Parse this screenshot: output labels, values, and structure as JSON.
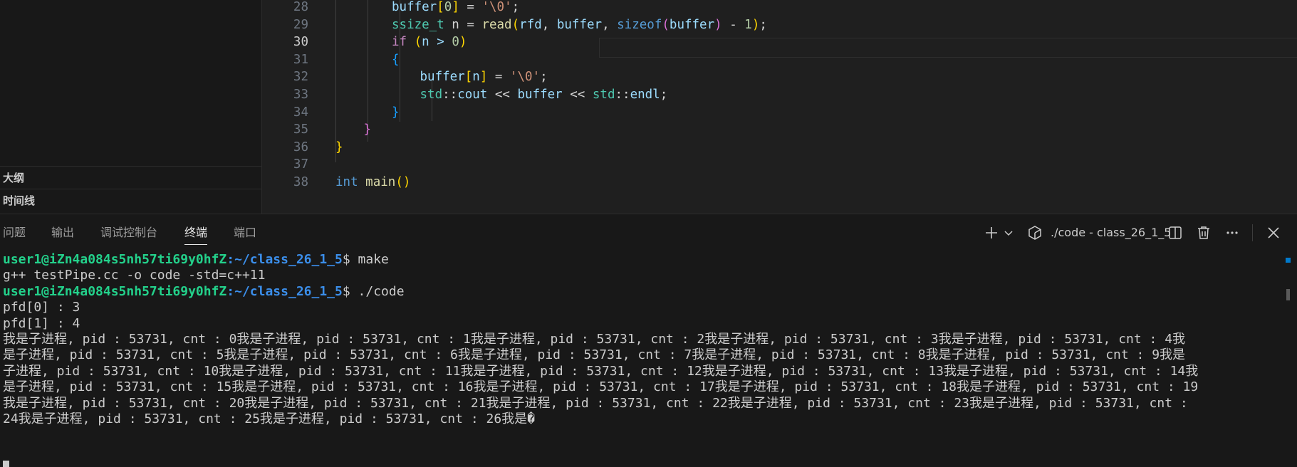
{
  "sidebar": {
    "sections": [
      "大纲",
      "时间线"
    ]
  },
  "editor": {
    "active_line": 30,
    "lines": [
      {
        "n": "28",
        "tokens": [
          [
            "buffer",
            "var"
          ],
          [
            "[",
            "b1"
          ],
          [
            "0",
            "num"
          ],
          [
            "]",
            "b1"
          ],
          [
            " = ",
            "op"
          ],
          [
            "'\\0'",
            "str"
          ],
          [
            ";",
            "op"
          ]
        ]
      },
      {
        "n": "29",
        "tokens": [
          [
            "ssize_t",
            "type"
          ],
          [
            " n = ",
            "op"
          ],
          [
            "read",
            "fn"
          ],
          [
            "(",
            "b1"
          ],
          [
            "rfd",
            "var"
          ],
          [
            ", ",
            "op"
          ],
          [
            "buffer",
            "var"
          ],
          [
            ", ",
            "op"
          ],
          [
            "sizeof",
            "kw"
          ],
          [
            "(",
            "b2"
          ],
          [
            "buffer",
            "var"
          ],
          [
            ")",
            "b2"
          ],
          [
            " - ",
            "op"
          ],
          [
            "1",
            "num"
          ],
          [
            ")",
            "b1"
          ],
          [
            ";",
            "op"
          ]
        ]
      },
      {
        "n": "30",
        "tokens": [
          [
            "if",
            "ctl"
          ],
          [
            " ",
            "op"
          ],
          [
            "(",
            "b1"
          ],
          [
            "n > ",
            "var"
          ],
          [
            "0",
            "num"
          ],
          [
            ")",
            "b1"
          ]
        ]
      },
      {
        "n": "31",
        "tokens": [
          [
            "{",
            "b3"
          ]
        ]
      },
      {
        "n": "32",
        "tokens": [
          [
            "buffer",
            "var"
          ],
          [
            "[",
            "b1"
          ],
          [
            "n",
            "var"
          ],
          [
            "]",
            "b1"
          ],
          [
            " = ",
            "op"
          ],
          [
            "'\\0'",
            "str"
          ],
          [
            ";",
            "op"
          ]
        ]
      },
      {
        "n": "33",
        "tokens": [
          [
            "std",
            "type"
          ],
          [
            "::",
            "op"
          ],
          [
            "cout",
            "var"
          ],
          [
            " << ",
            "op"
          ],
          [
            "buffer",
            "var"
          ],
          [
            " << ",
            "op"
          ],
          [
            "std",
            "type"
          ],
          [
            "::",
            "op"
          ],
          [
            "endl",
            "var"
          ],
          [
            ";",
            "op"
          ]
        ]
      },
      {
        "n": "34",
        "tokens": [
          [
            "}",
            "b3"
          ]
        ]
      },
      {
        "n": "35",
        "tokens": [
          [
            "}",
            "b2"
          ]
        ]
      },
      {
        "n": "36",
        "tokens": [
          [
            "}",
            "b1"
          ]
        ]
      },
      {
        "n": "37",
        "tokens": []
      },
      {
        "n": "38",
        "tokens": [
          [
            "int",
            "kw"
          ],
          [
            " ",
            "op"
          ],
          [
            "main",
            "fn"
          ],
          [
            "()",
            "b1"
          ]
        ]
      }
    ]
  },
  "panel": {
    "tabs": [
      "问题",
      "输出",
      "调试控制台",
      "终端",
      "端口"
    ],
    "active_tab": "终端",
    "terminal_title": "./code - class_26_1_5"
  },
  "terminal": {
    "lines": [
      {
        "user": "user1@iZn4a084s5nh57ti69y0hfZ",
        "path": ":~/class_26_1_5",
        "cmd": "$ make"
      },
      {
        "text": "g++ testPipe.cc -o code -std=c++11"
      },
      {
        "user": "user1@iZn4a084s5nh57ti69y0hfZ",
        "path": ":~/class_26_1_5",
        "cmd": "$ ./code"
      },
      {
        "text": "pfd[0] : 3"
      },
      {
        "text": "pfd[1] : 4"
      },
      {
        "text": "我是子进程, pid : 53731, cnt : 0我是子进程, pid : 53731, cnt : 1我是子进程, pid : 53731, cnt : 2我是子进程, pid : 53731, cnt : 3我是子进程, pid : 53731, cnt : 4我"
      },
      {
        "text": "是子进程, pid : 53731, cnt : 5我是子进程, pid : 53731, cnt : 6我是子进程, pid : 53731, cnt : 7我是子进程, pid : 53731, cnt : 8我是子进程, pid : 53731, cnt : 9我是"
      },
      {
        "text": "子进程, pid : 53731, cnt : 10我是子进程, pid : 53731, cnt : 11我是子进程, pid : 53731, cnt : 12我是子进程, pid : 53731, cnt : 13我是子进程, pid : 53731, cnt : 14我"
      },
      {
        "text": "是子进程, pid : 53731, cnt : 15我是子进程, pid : 53731, cnt : 16我是子进程, pid : 53731, cnt : 17我是子进程, pid : 53731, cnt : 18我是子进程, pid : 53731, cnt : 19"
      },
      {
        "text": "我是子进程, pid : 53731, cnt : 20我是子进程, pid : 53731, cnt : 21我是子进程, pid : 53731, cnt : 22我是子进程, pid : 53731, cnt : 23我是子进程, pid : 53731, cnt :"
      },
      {
        "text": "24我是子进程, pid : 53731, cnt : 25我是子进程, pid : 53731, cnt : 26我是�"
      }
    ]
  },
  "icons": [
    "plus-icon",
    "chevron-down-icon",
    "terminal-shell-icon",
    "split-terminal-icon",
    "trash-icon",
    "more-actions-icon",
    "close-panel-icon"
  ]
}
